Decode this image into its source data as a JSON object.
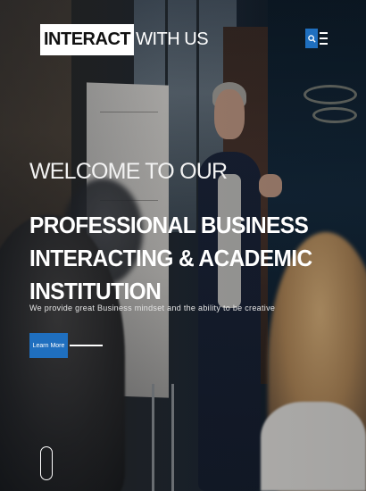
{
  "logo": {
    "boxed": "INTERACT",
    "rest": "WITH US"
  },
  "header": {
    "search_icon": "search-icon",
    "menu_icon": "hamburger-icon"
  },
  "hero": {
    "welcome": "WELCOME TO OUR",
    "headline": "PROFESSIONAL BUSINESS INTERACTING & ACADEMIC INSTITUTION",
    "subtext": "We provide great Business mindset and the ability to be creative",
    "cta_label": "Learn More"
  },
  "colors": {
    "accent": "#1f6fbf",
    "text": "#ffffff"
  }
}
